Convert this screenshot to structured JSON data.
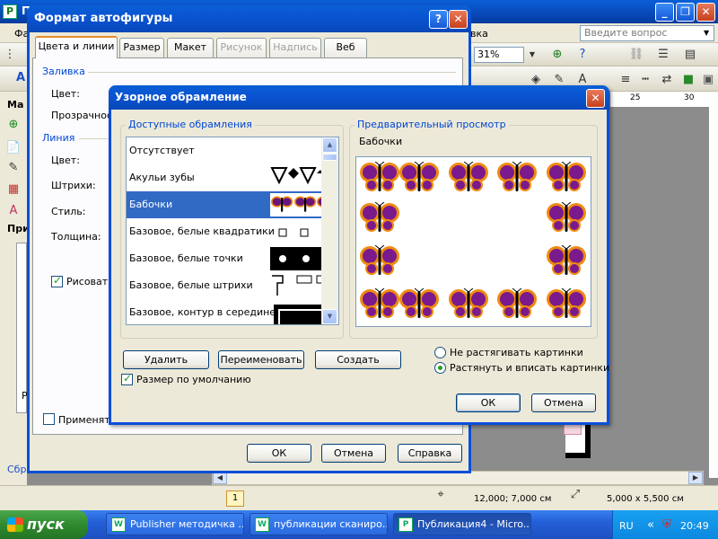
{
  "app": {
    "title": "П",
    "help_placeholder": "Введите вопрос",
    "zoom": "31%",
    "menu_fragments": [
      "Фа",
      "вка"
    ],
    "side_fragments": [
      "Ма",
      "При",
      "Р",
      "Сбро"
    ],
    "ruler_marks": [
      "25",
      "30"
    ],
    "status_position": "12,000; 7,000 см",
    "status_size": "5,000 x  5,500 см",
    "page_number": "1"
  },
  "dialog_format": {
    "title": "Формат автофигуры",
    "tabs": [
      {
        "label": "Цвета и линии",
        "state": "active"
      },
      {
        "label": "Размер",
        "state": "normal"
      },
      {
        "label": "Макет",
        "state": "normal"
      },
      {
        "label": "Рисунок",
        "state": "disabled"
      },
      {
        "label": "Надпись",
        "state": "disabled"
      },
      {
        "label": "Веб",
        "state": "normal"
      }
    ],
    "fill_group": "Заливка",
    "fill_color_label": "Цвет:",
    "transparency_label": "Прозрачност",
    "line_group": "Линия",
    "line_color_label": "Цвет:",
    "dashes_label": "Штрихи:",
    "style_label": "Стиль:",
    "weight_label": "Толщина:",
    "draw_checkbox_label": "Рисоват",
    "apply_checkbox_label": "Применять",
    "ok_label": "ОК",
    "cancel_label": "Отмена",
    "help_label": "Справка"
  },
  "dialog_borders": {
    "title": "Узорное обрамление",
    "available_group": "Доступные обрамления",
    "borders": [
      {
        "label": "Отсутствует",
        "sample": "none",
        "selected": false
      },
      {
        "label": "Акульи зубы",
        "sample": "teeth",
        "selected": false
      },
      {
        "label": "Бабочки",
        "sample": "butterflies",
        "selected": true
      },
      {
        "label": "Базовое, белые квадратики",
        "sample": "squares",
        "selected": false
      },
      {
        "label": "Базовое, белые точки",
        "sample": "dots",
        "selected": false
      },
      {
        "label": "Базовое, белые штрихи",
        "sample": "dashes",
        "selected": false
      },
      {
        "label": "Базовое, контур в середине",
        "sample": "outline",
        "selected": false
      }
    ],
    "preview_group": "Предварительный просмотр",
    "preview_name": "Бабочки",
    "delete_label": "Удалить",
    "rename_label": "Переименовать",
    "create_label": "Создать",
    "default_size_label": "Размер по умолчанию",
    "default_size_checked": true,
    "radio_no_stretch": "Не растягивать картинки",
    "radio_stretch": "Растянуть и вписать картинки",
    "radio_selected": "stretch",
    "ok_label": "ОК",
    "cancel_label": "Отмена"
  },
  "taskbar": {
    "start_label": "пуск",
    "tasks": [
      {
        "label": "Publisher методичка ...",
        "active": false
      },
      {
        "label": "публикации сканиро...",
        "active": false
      },
      {
        "label": "Публикация4 - Micro...",
        "active": true
      }
    ],
    "language": "RU",
    "clock": "20:49"
  },
  "colors": {
    "xp_blue": "#0a52d0",
    "selection": "#316ac5",
    "group_caption": "#0046d5",
    "butterfly_wing": "#7a1a8c",
    "butterfly_edge": "#f08a10"
  }
}
